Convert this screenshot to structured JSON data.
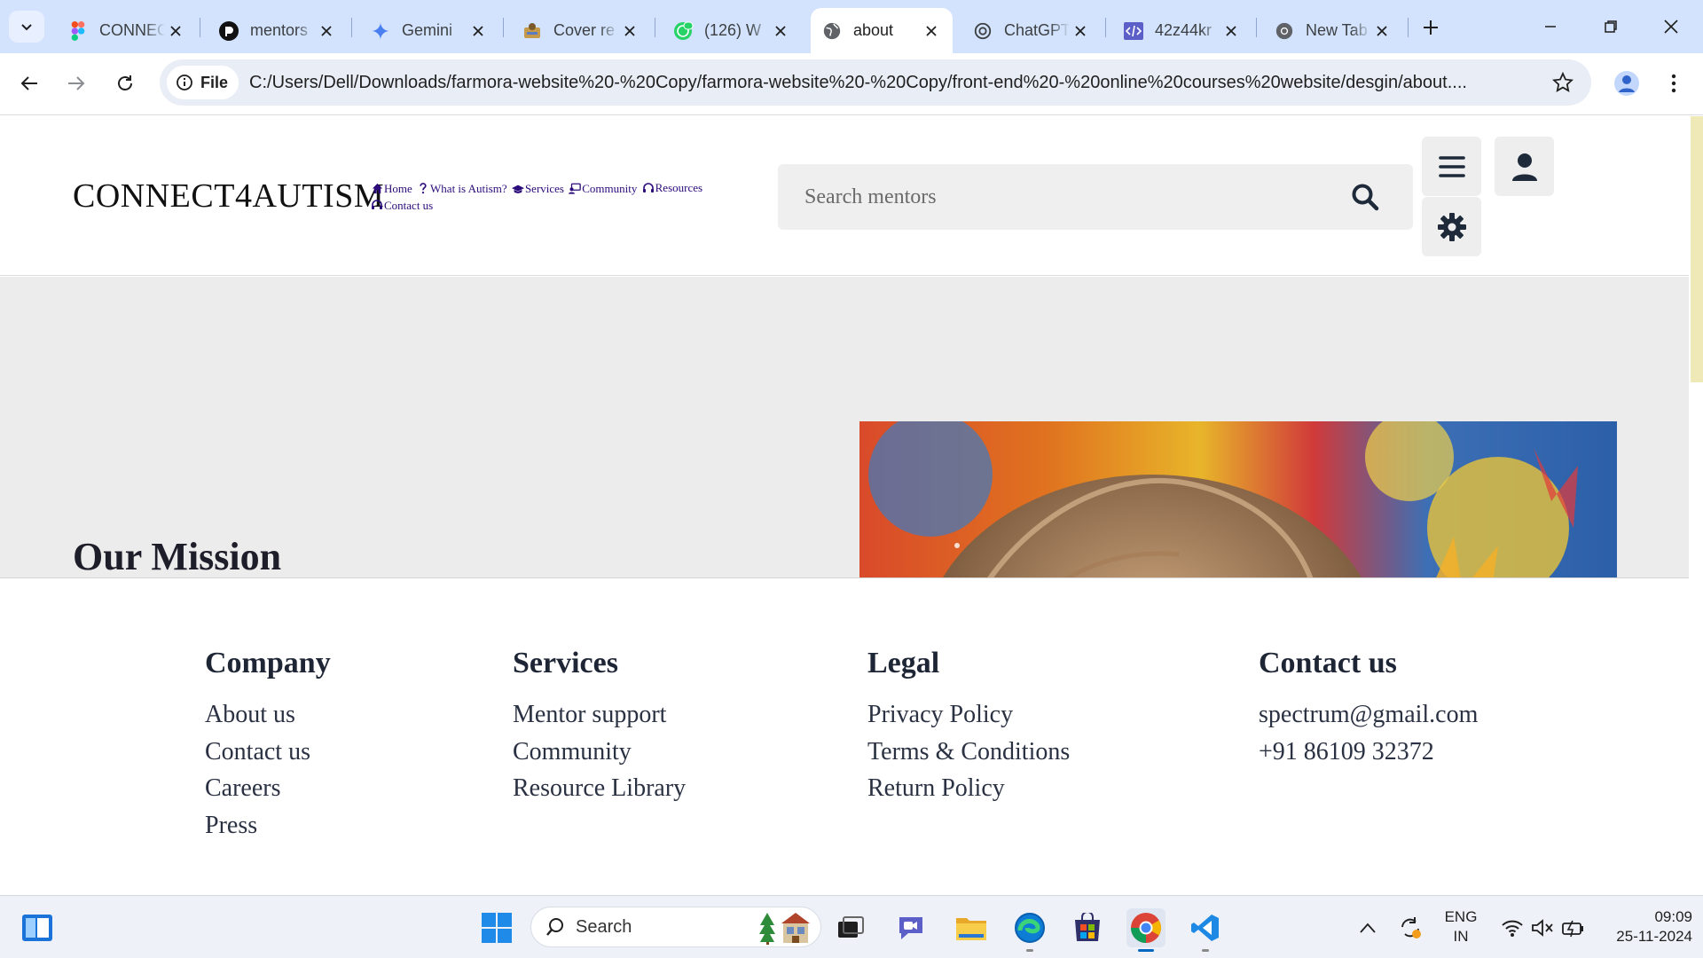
{
  "browser": {
    "tabs": [
      {
        "title": "CONNECT",
        "icon": "figma-icon"
      },
      {
        "title": "mentors",
        "icon": "github-copilot-icon"
      },
      {
        "title": "Gemini",
        "icon": "gemini-sparkle-icon"
      },
      {
        "title": "Cover re",
        "icon": "canva-icon"
      },
      {
        "title": "(126) W",
        "icon": "whatsapp-icon"
      },
      {
        "title": "about",
        "icon": "globe-icon",
        "active": true
      },
      {
        "title": "ChatGPT",
        "icon": "chatgpt-icon"
      },
      {
        "title": "42z44kr",
        "icon": "code-icon"
      },
      {
        "title": "New Tab",
        "icon": "chrome-icon"
      }
    ],
    "address": {
      "chip_label": "File",
      "url": "C:/Users/Dell/Downloads/farmora-website%20-%20Copy/farmora-website%20-%20Copy/front-end%20-%20online%20courses%20website/desgin/about...."
    }
  },
  "site": {
    "logo": "CONNECT4AUTISM",
    "nav": [
      {
        "label": "Home",
        "icon": "home-icon"
      },
      {
        "label": "What is Autism?",
        "icon": "question-icon"
      },
      {
        "label": "Services",
        "icon": "graduation-cap-icon"
      },
      {
        "label": "Community",
        "icon": "people-icon"
      },
      {
        "label": "Resources",
        "icon": "headset-icon"
      },
      {
        "label": "Contact us",
        "icon": "support-icon"
      }
    ],
    "search_placeholder": "Search mentors",
    "hero": {
      "heading": "Our Mission",
      "image_alt": "child with paint on face and colorful handprints"
    },
    "footer": {
      "columns": [
        {
          "title": "Company",
          "links": [
            "About us",
            "Contact us",
            "Careers",
            "Press"
          ]
        },
        {
          "title": "Services",
          "links": [
            "Mentor support",
            "Community",
            "Resource Library"
          ]
        },
        {
          "title": "Legal",
          "links": [
            "Privacy Policy",
            "Terms & Conditions",
            "Return Policy"
          ]
        },
        {
          "title": "Contact us",
          "links": [
            "spectrum@gmail.com",
            "+91 86109 32372"
          ]
        }
      ]
    }
  },
  "taskbar": {
    "search_label": "Search",
    "language": {
      "line1": "ENG",
      "line2": "IN"
    },
    "clock": {
      "time": "09:09",
      "date": "25-11-2024"
    }
  },
  "colors": {
    "tabstrip": "#d3e3fd",
    "nav_link": "#2b0a7a",
    "hero_bg": "#ececec",
    "heading": "#1e2535"
  }
}
